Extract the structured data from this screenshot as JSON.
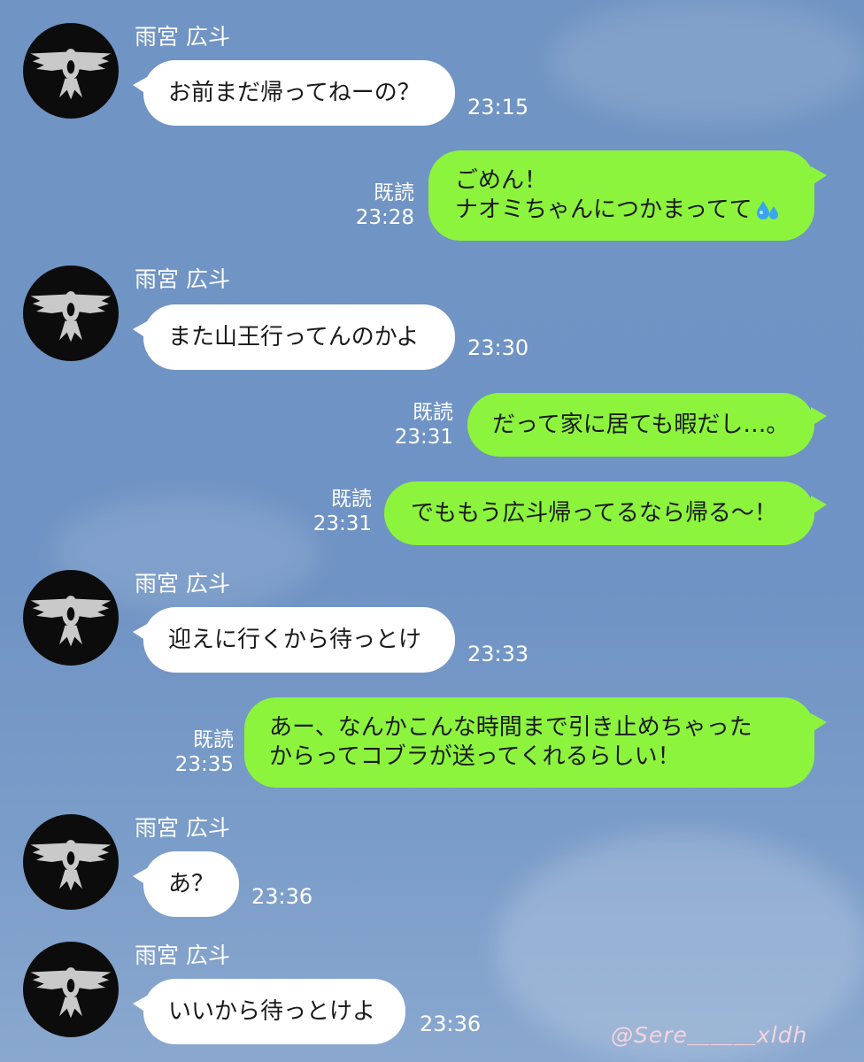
{
  "chat": {
    "sender_name": "雨宮 広斗",
    "read_label": "既読",
    "messages": [
      {
        "text": "お前まだ帰ってねーの？",
        "time": "23:15"
      },
      {
        "line1": "ごめん！",
        "line2": "ナオミちゃんにつかまってて",
        "emoji": "sweat-droplets-icon",
        "time": "23:28"
      },
      {
        "text": "また山王行ってんのかよ",
        "time": "23:30"
      },
      {
        "text": "だって家に居ても暇だし…。",
        "time": "23:31"
      },
      {
        "text": "でももう広斗帰ってるなら帰る～！",
        "time": "23:31"
      },
      {
        "text": "迎えに行くから待っとけ",
        "time": "23:33"
      },
      {
        "line1": "あー、なんかこんな時間まで引き止めちゃった",
        "line2": "からってコブラが送ってくれるらしい！",
        "time": "23:35"
      },
      {
        "text": "あ？",
        "time": "23:36"
      },
      {
        "text": "いいから待っとけよ",
        "time": "23:36"
      }
    ]
  },
  "watermark": "@Sere＿＿＿xldh",
  "colors": {
    "background": "#7094c3",
    "outgoing_bubble": "#8cf43d",
    "incoming_bubble": "#ffffff"
  }
}
